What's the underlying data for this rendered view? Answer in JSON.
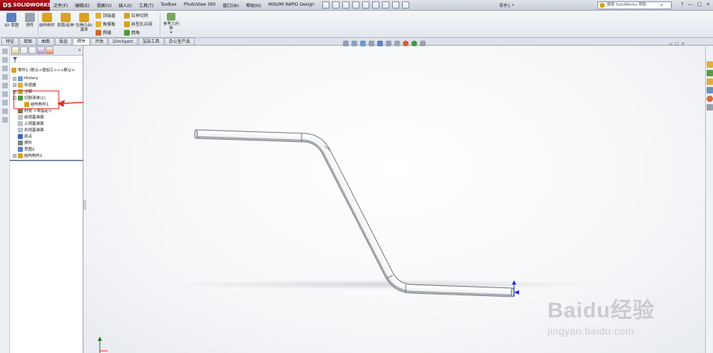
{
  "app": {
    "logo_text": "SOLIDWORKS",
    "doc_title": "零件1 *",
    "search_placeholder": "搜索 SolidWorks 帮助",
    "window_controls": [
      "?",
      "—",
      "□",
      "×"
    ]
  },
  "menu": [
    "文件(F)",
    "编辑(E)",
    "视图(V)",
    "插入(I)",
    "工具(T)",
    "Toolbox",
    "PhotoView 360",
    "窗口(W)",
    "帮助(H)",
    "MISUMI RAPID Design"
  ],
  "ribbon": {
    "big_buttons": [
      {
        "label": "3D 草图",
        "color": "#5a7fc2"
      },
      {
        "label": "焊件",
        "color": "#9aa3ad"
      },
      {
        "label": "结构构件",
        "color": "#d8a123"
      },
      {
        "label": "剪裁/延伸",
        "color": "#d8a123"
      },
      {
        "label": "拉伸凸台/基体",
        "color": "#d8a123"
      }
    ],
    "small_col1": [
      "顶端盖",
      "角撑板",
      "焊缝"
    ],
    "small_col2": [
      "拉伸切除",
      "异型孔向导",
      "倒角"
    ],
    "ref_geometry": "参考几何体"
  },
  "tabs": [
    {
      "label": "特征",
      "active": false
    },
    {
      "label": "草图",
      "active": false
    },
    {
      "label": "曲面",
      "active": false
    },
    {
      "label": "钣金",
      "active": false
    },
    {
      "label": "焊件",
      "active": true
    },
    {
      "label": "评估",
      "active": false
    },
    {
      "label": "DimXpert",
      "active": false
    },
    {
      "label": "渲染工具",
      "active": false
    },
    {
      "label": "办公室产品",
      "active": false
    }
  ],
  "tree": {
    "root": "零件1 (默认<按加工><<默认>",
    "items": [
      {
        "label": "History",
        "icon": "history-icon",
        "expand": "+"
      },
      {
        "label": "传感器",
        "icon": "sensor-icon",
        "expand": "+"
      },
      {
        "label": "注解",
        "icon": "annotation-icon",
        "expand": "+"
      },
      {
        "label": "切割清单(1)",
        "icon": "cut-list-icon",
        "expand": "−"
      },
      {
        "label": "结构构件1",
        "icon": "structural-member-icon",
        "expand": ""
      },
      {
        "label": "材质 <未指定>",
        "icon": "material-icon",
        "expand": ""
      },
      {
        "label": "前视基准面",
        "icon": "plane-icon",
        "expand": ""
      },
      {
        "label": "上视基准面",
        "icon": "plane-icon",
        "expand": ""
      },
      {
        "label": "右视基准面",
        "icon": "plane-icon",
        "expand": ""
      },
      {
        "label": "原点",
        "icon": "origin-icon",
        "expand": ""
      },
      {
        "label": "焊件",
        "icon": "weldment-icon",
        "expand": ""
      },
      {
        "label": "草图2",
        "icon": "sketch-icon",
        "expand": ""
      },
      {
        "label": "结构构件1",
        "icon": "structural-member-icon",
        "expand": "+"
      }
    ]
  },
  "watermark": {
    "brand": "Baidu经验",
    "url": "jingyan.baidu.com"
  },
  "colors": {
    "accent_red": "#e2332d",
    "triad_blue": "#1b2fd6",
    "pipe_light": "#ffffff",
    "pipe_dark": "#8f959c"
  }
}
